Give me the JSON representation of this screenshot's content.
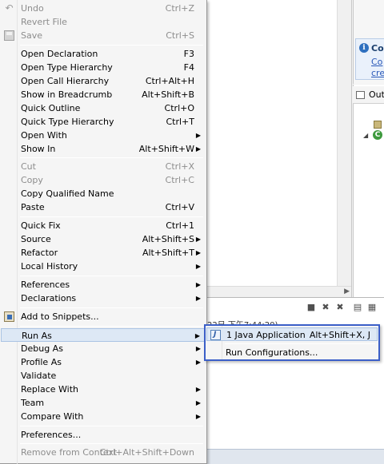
{
  "background": {
    "info_panel": {
      "title": "Co",
      "link_1": "Co",
      "link_2": "cre"
    },
    "outline_tab_label": "Out",
    "console_timestamp": "22日 下午7:44:20)"
  },
  "context_menu": {
    "items": [
      {
        "label": "Undo",
        "shortcut": "Ctrl+Z",
        "disabled": true,
        "icon": "undo-icon"
      },
      {
        "label": "Revert File",
        "shortcut": "",
        "disabled": true
      },
      {
        "label": "Save",
        "shortcut": "Ctrl+S",
        "disabled": true,
        "icon": "save-icon"
      },
      {
        "label": "Open Declaration",
        "shortcut": "F3"
      },
      {
        "label": "Open Type Hierarchy",
        "shortcut": "F4"
      },
      {
        "label": "Open Call Hierarchy",
        "shortcut": "Ctrl+Alt+H"
      },
      {
        "label": "Show in Breadcrumb",
        "shortcut": "Alt+Shift+B"
      },
      {
        "label": "Quick Outline",
        "shortcut": "Ctrl+O"
      },
      {
        "label": "Quick Type Hierarchy",
        "shortcut": "Ctrl+T"
      },
      {
        "label": "Open With",
        "shortcut": "",
        "submenu": true
      },
      {
        "label": "Show In",
        "shortcut": "Alt+Shift+W",
        "submenu": true
      },
      {
        "label": "Cut",
        "shortcut": "Ctrl+X",
        "disabled": true
      },
      {
        "label": "Copy",
        "shortcut": "Ctrl+C",
        "disabled": true
      },
      {
        "label": "Copy Qualified Name",
        "shortcut": ""
      },
      {
        "label": "Paste",
        "shortcut": "Ctrl+V"
      },
      {
        "label": "Quick Fix",
        "shortcut": "Ctrl+1"
      },
      {
        "label": "Source",
        "shortcut": "Alt+Shift+S",
        "submenu": true
      },
      {
        "label": "Refactor",
        "shortcut": "Alt+Shift+T",
        "submenu": true
      },
      {
        "label": "Local History",
        "shortcut": "",
        "submenu": true
      },
      {
        "label": "References",
        "shortcut": "",
        "submenu": true
      },
      {
        "label": "Declarations",
        "shortcut": "",
        "submenu": true
      },
      {
        "label": "Add to Snippets...",
        "shortcut": "",
        "icon": "snippets-icon"
      },
      {
        "label": "Run As",
        "shortcut": "",
        "submenu": true,
        "highlighted": true
      },
      {
        "label": "Debug As",
        "shortcut": "",
        "submenu": true
      },
      {
        "label": "Profile As",
        "shortcut": "",
        "submenu": true
      },
      {
        "label": "Validate",
        "shortcut": ""
      },
      {
        "label": "Replace With",
        "shortcut": "",
        "submenu": true
      },
      {
        "label": "Team",
        "shortcut": "",
        "submenu": true
      },
      {
        "label": "Compare With",
        "shortcut": "",
        "submenu": true
      },
      {
        "label": "Preferences...",
        "shortcut": ""
      },
      {
        "label": "Remove from Context",
        "shortcut": "Ctrl+Alt+Shift+Down",
        "disabled": true
      }
    ]
  },
  "run_as_submenu": {
    "items": [
      {
        "label": "1 Java Application",
        "shortcut": "Alt+Shift+X, J",
        "icon": "java-app-icon",
        "highlighted": true
      },
      {
        "label": "Run Configurations...",
        "shortcut": ""
      }
    ]
  },
  "colors": {
    "menu_background": "#f5f5f5",
    "highlight": "#dde8f5",
    "submenu_border": "#3b5fc8",
    "disabled_text": "#8d8d8d"
  }
}
